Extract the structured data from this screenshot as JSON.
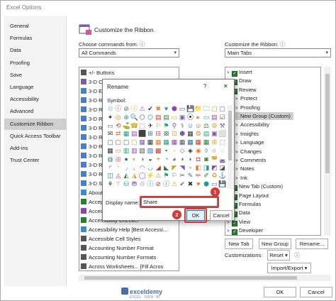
{
  "window": {
    "title": "Excel Options"
  },
  "nav": {
    "items": [
      "General",
      "Formulas",
      "Data",
      "Proofing",
      "Save",
      "Language",
      "Accessibility",
      "Advanced",
      "Customize Ribbon",
      "Quick Access Toolbar",
      "Add-ins",
      "Trust Center"
    ],
    "selected": "Customize Ribbon"
  },
  "header": {
    "title": "Customize the Ribbon."
  },
  "left": {
    "label": "Choose commands from:",
    "info": "ⓘ",
    "value": "All Commands",
    "commands": [
      "+/-  Buttons",
      "3-D Colo",
      "3-D Eff",
      "3-D Ro",
      "3-D Ro",
      "3-D Ro",
      "3-D Ro",
      "3-D Ro",
      "3-D Ro",
      "3-D Ro",
      "3-D Ro",
      "3-D Ro",
      "3-D Styl",
      "About",
      "Accept",
      "Access",
      "Accessibility Checker",
      "Accessibility Help [Best Accessi...",
      "Accessible Cell Styles",
      "Accounting Number Format",
      "Accounting Number Formats",
      "Across Worksheets... [Fill Acros"
    ]
  },
  "right": {
    "label": "Customize the Ribbon:",
    "info": "ⓘ",
    "value": "Main Tabs",
    "items": [
      {
        "text": "Insert",
        "indent": 0,
        "check": true,
        "expander": ">"
      },
      {
        "text": "Draw",
        "indent": 0,
        "check": true,
        "expander": ">"
      },
      {
        "text": "Review",
        "indent": 0,
        "check": true,
        "expander": "v"
      },
      {
        "text": "Protect",
        "indent": 1,
        "check": false,
        "expander": ">"
      },
      {
        "text": "Proofing",
        "indent": 1,
        "check": false,
        "expander": ">"
      },
      {
        "text": "New Group (Custom)",
        "indent": 1,
        "check": false,
        "expander": "",
        "selected": true
      },
      {
        "text": "Accessibility",
        "indent": 1,
        "check": false,
        "expander": ">"
      },
      {
        "text": "Insights",
        "indent": 1,
        "check": false,
        "expander": ">"
      },
      {
        "text": "Language",
        "indent": 1,
        "check": false,
        "expander": ">"
      },
      {
        "text": "Changes",
        "indent": 1,
        "check": false,
        "expander": ">"
      },
      {
        "text": "Comments",
        "indent": 1,
        "check": false,
        "expander": ">"
      },
      {
        "text": "Notes",
        "indent": 1,
        "check": false,
        "expander": ">"
      },
      {
        "text": "Ink",
        "indent": 1,
        "check": false,
        "expander": ">"
      },
      {
        "text": "New Tab (Custom)",
        "indent": 0,
        "check": true,
        "expander": ">"
      },
      {
        "text": "Page Layout",
        "indent": 0,
        "check": true,
        "expander": ">"
      },
      {
        "text": "Formulas",
        "indent": 0,
        "check": true,
        "expander": ">"
      },
      {
        "text": "Data",
        "indent": 0,
        "check": true,
        "expander": ">"
      },
      {
        "text": "View",
        "indent": 0,
        "check": true,
        "expander": ">"
      },
      {
        "text": "Developer",
        "indent": 0,
        "check": true,
        "expander": ">"
      }
    ],
    "new_tab": "New Tab",
    "new_group": "New Group",
    "rename": "Rename...",
    "customizations_label": "Customizations:",
    "reset": "Reset ▾",
    "import_export": "Import/Export ▾",
    "info2": "ⓘ"
  },
  "dialog": {
    "title": "Rename",
    "help": "?",
    "close": "✕",
    "symbol_label": "Symbol:",
    "display_name_label": "Display name:",
    "display_name_value": "Share",
    "ok": "OK",
    "cancel": "Cancel",
    "badge1": "1",
    "badge2": "2",
    "symbols": [
      "♲",
      "ⓘ",
      "⊘",
      "ⓘ",
      "⚠",
      "✔",
      "✖",
      "♥",
      "⬢",
      "▭",
      "💾",
      "📁",
      "🗀",
      "▢",
      "▢",
      "✦",
      "◎",
      "⊕",
      "🔍",
      "⬡",
      "⬡",
      "▤",
      "▤",
      "▭",
      "▣",
      "⦿",
      "▸",
      "▭",
      "▤",
      "☑",
      "▭",
      "⟲",
      "⛳",
      "☎",
      "⬚",
      "✈",
      "⚐",
      "⚑",
      "⚲",
      "⚕",
      "☺",
      "☺",
      "⚖",
      "⚙",
      "⚒",
      "✉",
      "⇄",
      "▦",
      "▤",
      "⬛",
      "⊞",
      "⊟",
      "⊠",
      "⊡",
      "⬢",
      "▦",
      "⚙",
      "▤",
      "▣",
      "⬜",
      "▢",
      "▢",
      "▢",
      "▢",
      "▦",
      "▦",
      "▦",
      "▦",
      "▦",
      "▦",
      "▦",
      "▦",
      "▦",
      "⊞",
      "⬚",
      "▦",
      "▭",
      "▥",
      "▥",
      "▧",
      "▨",
      "▩",
      "▪",
      "▫",
      "◇",
      "◈",
      "◉",
      "◊",
      "○",
      "◌",
      "◍",
      "◎",
      "●",
      "◐",
      "◑",
      "◒",
      "◓",
      "◔",
      "◕",
      "◖",
      "◗",
      "◘",
      "◙",
      "◚",
      "◛",
      "◜",
      "◝",
      "◞",
      "◟",
      "◠",
      "◡",
      "◢",
      "◣",
      "◤",
      "◥",
      "◦",
      "◧",
      "◨",
      "◩",
      "◪",
      "◫",
      "◬",
      "◭",
      "◮",
      "◯",
      "⚡",
      "⚠",
      "⚑",
      "⚐",
      "✂",
      "✎",
      "✏",
      "✐",
      "♻",
      "⚓",
      "⚘",
      "⚚",
      "⛁",
      "⛃"
    ]
  },
  "footer": {
    "ok": "OK",
    "cancel": "Cancel",
    "watermark": "exceldemy",
    "watermark_sub": "EXCEL · DATA · BI"
  },
  "colors": {
    "badge": "#d93636",
    "check": "#2e7d32",
    "selected": "#cfcfcf"
  }
}
